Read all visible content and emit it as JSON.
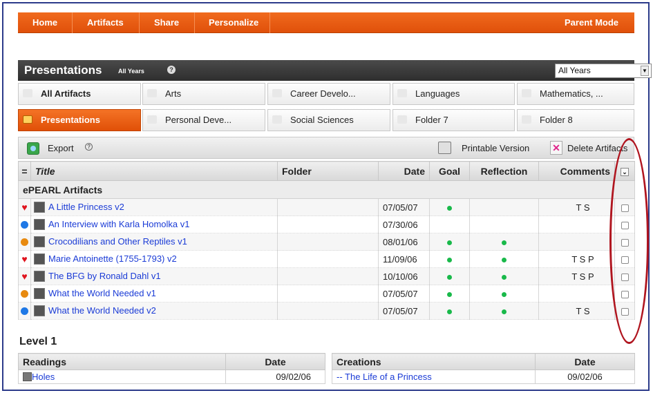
{
  "nav": {
    "home": "Home",
    "artifacts": "Artifacts",
    "share": "Share",
    "personalize": "Personalize",
    "parent_mode": "Parent Mode"
  },
  "header": {
    "title": "Presentations",
    "subtitle": "All Years",
    "help": "?",
    "year_select": "All Years"
  },
  "tabs": [
    "All Artifacts",
    "Arts",
    "Career Develo...",
    "Languages",
    "Mathematics, ...",
    "Presentations",
    "Personal Deve...",
    "Social Sciences",
    "Folder 7",
    "Folder 8"
  ],
  "toolbar": {
    "export": "Export",
    "export_help": "?",
    "printable": "Printable Version",
    "delete": "Delete Artifacts"
  },
  "table": {
    "columns": {
      "marker": "=",
      "title": "Title",
      "folder": "Folder",
      "date": "Date",
      "goal": "Goal",
      "reflection": "Reflection",
      "comments": "Comments"
    },
    "section": "ePEARL Artifacts",
    "rows": [
      {
        "marker": "heart",
        "title": "A Little Princess v2",
        "folder": "",
        "date": "07/05/07",
        "goal": true,
        "reflection": false,
        "comments": "T S"
      },
      {
        "marker": "blue",
        "title": "An Interview with Karla Homolka v1",
        "folder": "",
        "date": "07/30/06",
        "goal": false,
        "reflection": false,
        "comments": ""
      },
      {
        "marker": "orange",
        "title": "Crocodilians and Other Reptiles v1",
        "folder": "",
        "date": "08/01/06",
        "goal": true,
        "reflection": true,
        "comments": ""
      },
      {
        "marker": "heart",
        "title": "Marie Antoinette (1755-1793) v2",
        "folder": "",
        "date": "11/09/06",
        "goal": true,
        "reflection": true,
        "comments": "T S P"
      },
      {
        "marker": "heart",
        "title": "The BFG by Ronald Dahl v1",
        "folder": "",
        "date": "10/10/06",
        "goal": true,
        "reflection": true,
        "comments": "T S P"
      },
      {
        "marker": "orange",
        "title": "What the World Needed v1",
        "folder": "",
        "date": "07/05/07",
        "goal": true,
        "reflection": true,
        "comments": ""
      },
      {
        "marker": "blue",
        "title": "What the World Needed v2",
        "folder": "",
        "date": "07/05/07",
        "goal": true,
        "reflection": true,
        "comments": "T S"
      }
    ]
  },
  "level": {
    "title": "Level 1",
    "readings": {
      "header": "Readings",
      "date_header": "Date",
      "item": "Holes",
      "date": "09/02/06"
    },
    "creations": {
      "header": "Creations",
      "date_header": "Date",
      "item": "-- The Life of a Princess",
      "date": "09/02/06"
    }
  },
  "colors": {
    "accent": "#e8560e",
    "link": "#1a3bd6",
    "goal_dot": "#19b94a",
    "heart": "#e0141e",
    "ball_blue": "#1e78e6",
    "ball_orange": "#e88a10",
    "annotation": "#b0151f"
  }
}
